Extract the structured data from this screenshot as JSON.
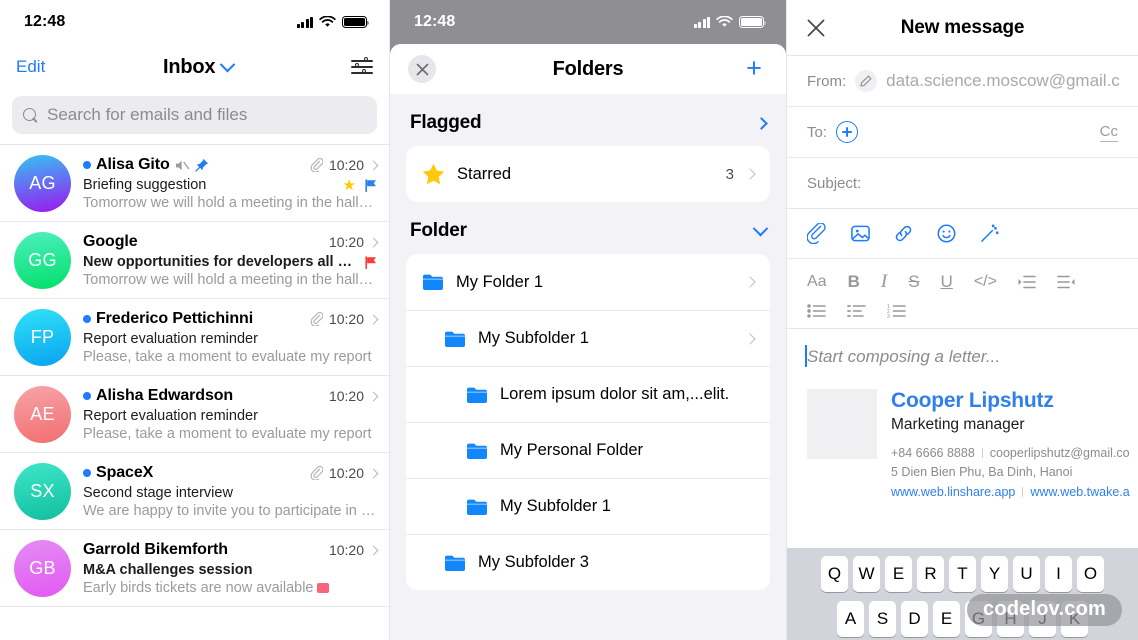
{
  "inbox": {
    "status_bar": {
      "time": "12:48"
    },
    "edit_label": "Edit",
    "title": "Inbox",
    "filter_icon": "sliders-icon",
    "chevron_icon": "chevron-down-icon",
    "search": {
      "placeholder": "Search for emails and files",
      "icon": "search-icon"
    },
    "emails": [
      {
        "initials": "AG",
        "sender": "Alisa Gito",
        "subject": "Briefing suggestion",
        "preview": "Tomorrow we will hold a meeting in the hall in..",
        "time": "10:20",
        "unread": true,
        "muted": true,
        "pinned": true,
        "attachment": true,
        "starred": true,
        "flagged": true,
        "flag_color": "#2f80ed",
        "avatar_from": "#35c3f3",
        "avatar_to": "#9b16f0"
      },
      {
        "initials": "GG",
        "sender": "Google",
        "subject": "New opportunities for developers all over...",
        "preview": "Tomorrow we will hold a meeting in the hall in..",
        "time": "10:20",
        "unread": false,
        "muted": false,
        "pinned": false,
        "attachment": false,
        "starred": false,
        "flagged": true,
        "flag_color": "#fa3c3c",
        "avatar_from": "#4ef0c0",
        "avatar_to": "#00e06a"
      },
      {
        "initials": "FP",
        "sender": "Frederico Pettichinni",
        "subject": "Report evaluation reminder",
        "preview": "Please, take a moment to evaluate my report",
        "time": "10:20",
        "unread": true,
        "muted": false,
        "pinned": false,
        "attachment": true,
        "starred": false,
        "flagged": false,
        "flag_color": "",
        "avatar_from": "#2fe2f8",
        "avatar_to": "#0aa3f0"
      },
      {
        "initials": "AE",
        "sender": "Alisha Edwardson",
        "subject": "Report evaluation reminder",
        "preview": "Please, take a moment to evaluate my report",
        "time": "10:20",
        "unread": true,
        "muted": false,
        "pinned": false,
        "attachment": false,
        "starred": false,
        "flagged": false,
        "flag_color": "",
        "avatar_from": "#f7a5a8",
        "avatar_to": "#f26d70"
      },
      {
        "initials": "SX",
        "sender": "SpaceX",
        "subject": "Second stage interview",
        "preview": "We are happy to invite you to participate in a...",
        "time": "10:20",
        "unread": true,
        "muted": false,
        "pinned": false,
        "attachment": true,
        "starred": false,
        "flagged": false,
        "flag_color": "",
        "avatar_from": "#3ee6c8",
        "avatar_to": "#12bfa0"
      },
      {
        "initials": "GB",
        "sender": "Garrold Bikemforth",
        "subject": "M&A challenges session",
        "preview": "Early birds tickets are now available",
        "time": "10:20",
        "unread": false,
        "muted": false,
        "pinned": false,
        "attachment": false,
        "starred": false,
        "flagged": false,
        "flag_color": "",
        "has_emoji_badge": true,
        "avatar_from": "#e58cf5",
        "avatar_to": "#e259f2"
      }
    ]
  },
  "folders": {
    "status_bar": {
      "time": "12:48"
    },
    "close_icon": "close-icon",
    "title": "Folders",
    "add_label": "+",
    "sections": [
      {
        "title": "Flagged",
        "arrow": "chevron-right-icon",
        "items": [
          {
            "label": "Starred",
            "count": "3",
            "icon": "star-icon",
            "indent": 0
          }
        ]
      },
      {
        "title": "Folder",
        "arrow": "chevron-down-icon",
        "items": [
          {
            "label": "My Folder 1",
            "count": "",
            "icon": "folder-icon",
            "indent": 0,
            "chevron": true
          },
          {
            "label": "My Subfolder 1",
            "count": "",
            "icon": "folder-icon",
            "indent": 1,
            "chevron": true
          },
          {
            "label": "Lorem ipsum dolor sit am,...elit.",
            "count": "",
            "icon": "folder-icon",
            "indent": 2,
            "chevron": false
          },
          {
            "label": "My Personal Folder",
            "count": "",
            "icon": "folder-icon",
            "indent": 2,
            "chevron": false
          },
          {
            "label": "My Subfolder 1",
            "count": "",
            "icon": "folder-icon",
            "indent": 2,
            "chevron": false
          },
          {
            "label": "My Subfolder 3",
            "count": "",
            "icon": "folder-icon",
            "indent": 1,
            "chevron": false
          }
        ]
      }
    ]
  },
  "new_message": {
    "close_icon": "close-icon",
    "title": "New message",
    "from_label": "From:",
    "from_value": "data.science.moscow@gmail.c",
    "edit_icon": "pencil-icon",
    "to_label": "To:",
    "to_add_icon": "plus-circle-icon",
    "cc_label": "Cc",
    "subject_label": "Subject:",
    "attach_tools": [
      "paperclip-icon",
      "image-icon",
      "link-icon",
      "emoji-icon",
      "magic-wand-icon"
    ],
    "format_row_1": [
      "Aa",
      "B",
      "I",
      "S",
      "U",
      "</>",
      "indent-increase-icon",
      "indent-decrease-icon"
    ],
    "format_row_2": [
      "bullet-list-icon",
      "dash-list-icon",
      "numbered-list-icon"
    ],
    "body_placeholder": "Start composing a letter...",
    "signature": {
      "name": "Cooper Lipshutz",
      "role": "Marketing manager",
      "phone": "+84 6666 8888",
      "email": "cooperlipshutz@gmail.co",
      "address": "5 Dien Bien Phu, Ba Dinh, Hanoi",
      "link1": "www.web.linshare.app",
      "link2": "www.web.twake.a"
    },
    "keyboard": {
      "row1": [
        "Q",
        "W",
        "E",
        "R",
        "T",
        "Y",
        "U",
        "I",
        "O"
      ],
      "row2": [
        "A",
        "S",
        "D",
        "E",
        "G",
        "H",
        "J",
        "K"
      ]
    }
  },
  "watermark": "codelov.com",
  "colors": {
    "accent_blue": "#1f7aff",
    "link_blue": "#2f80ed",
    "star_yellow": "#ffc800",
    "flag_red": "#fa3c3c",
    "gray_text": "#8b8b90",
    "sheet_bg": "#f2f2f7",
    "modal_backdrop": "#8e8e93"
  }
}
